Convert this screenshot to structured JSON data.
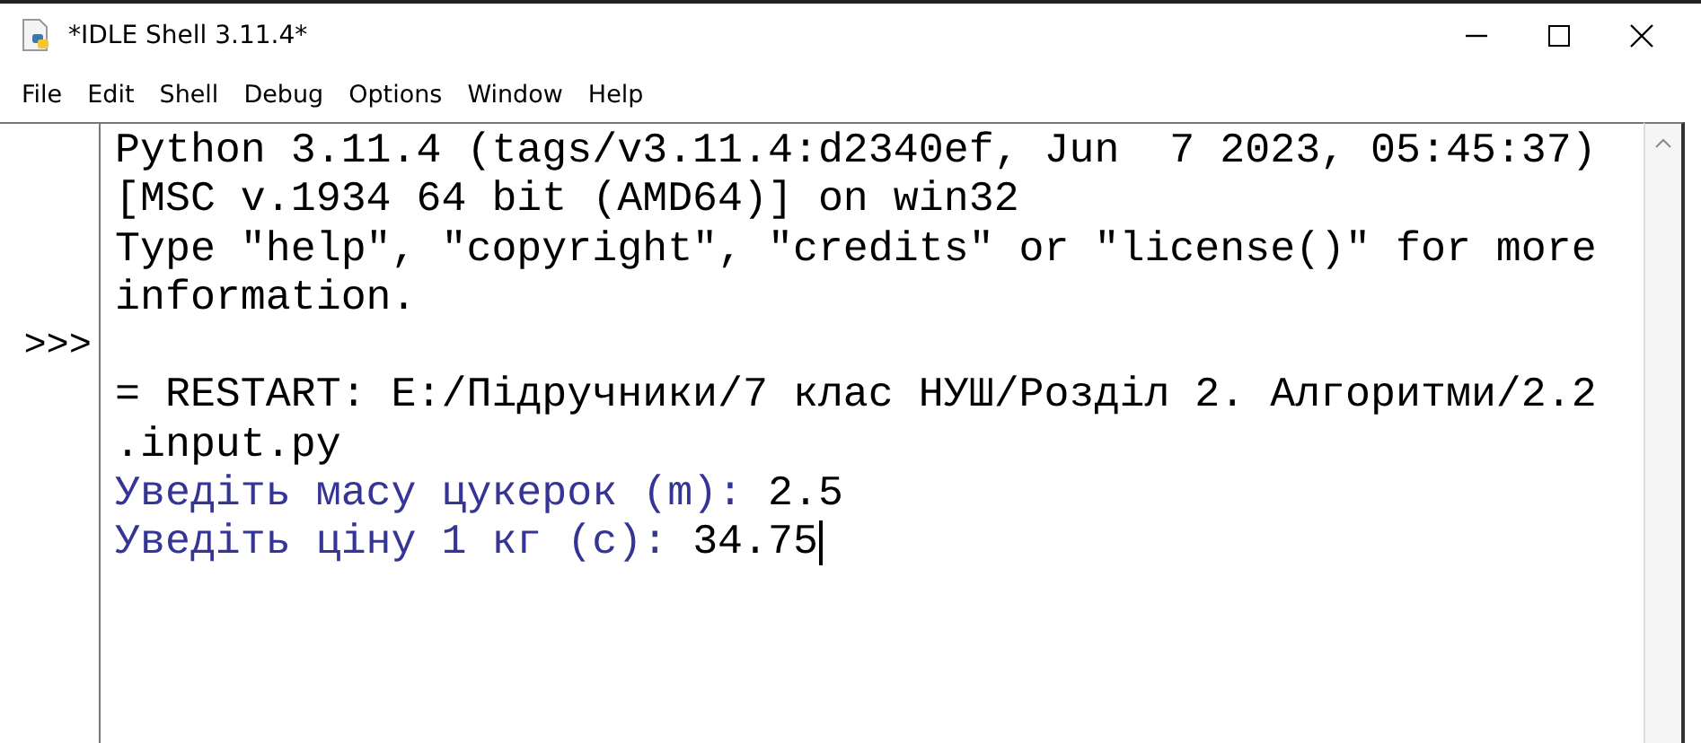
{
  "window": {
    "title": "*IDLE Shell 3.11.4*"
  },
  "menu": [
    "File",
    "Edit",
    "Shell",
    "Debug",
    "Options",
    "Window",
    "Help"
  ],
  "shell": {
    "lines": [
      {
        "kind": "output",
        "text": "Python 3.11.4 (tags/v3.11.4:d2340ef, Jun  7 2023, 05:45:37)"
      },
      {
        "kind": "output",
        "text": "[MSC v.1934 64 bit (AMD64)] on win32"
      },
      {
        "kind": "output",
        "text": "Type \"help\", \"copyright\", \"credits\" or \"license()\" for more"
      },
      {
        "kind": "output",
        "text": "information."
      },
      {
        "kind": "blank",
        "gutter": ">>>"
      },
      {
        "kind": "output",
        "text": "= RESTART: E:/Підручники/7 клас НУШ/Розділ 2. Алгоритми/2.2"
      },
      {
        "kind": "output",
        "text": ".input.py"
      },
      {
        "kind": "input",
        "prompt": "Уведіть масу цукерок (m):",
        "value": "2.5",
        "cursor": false
      },
      {
        "kind": "input",
        "prompt": "Уведіть ціну 1 кг (c):",
        "value": "34.75",
        "cursor": true
      }
    ]
  }
}
